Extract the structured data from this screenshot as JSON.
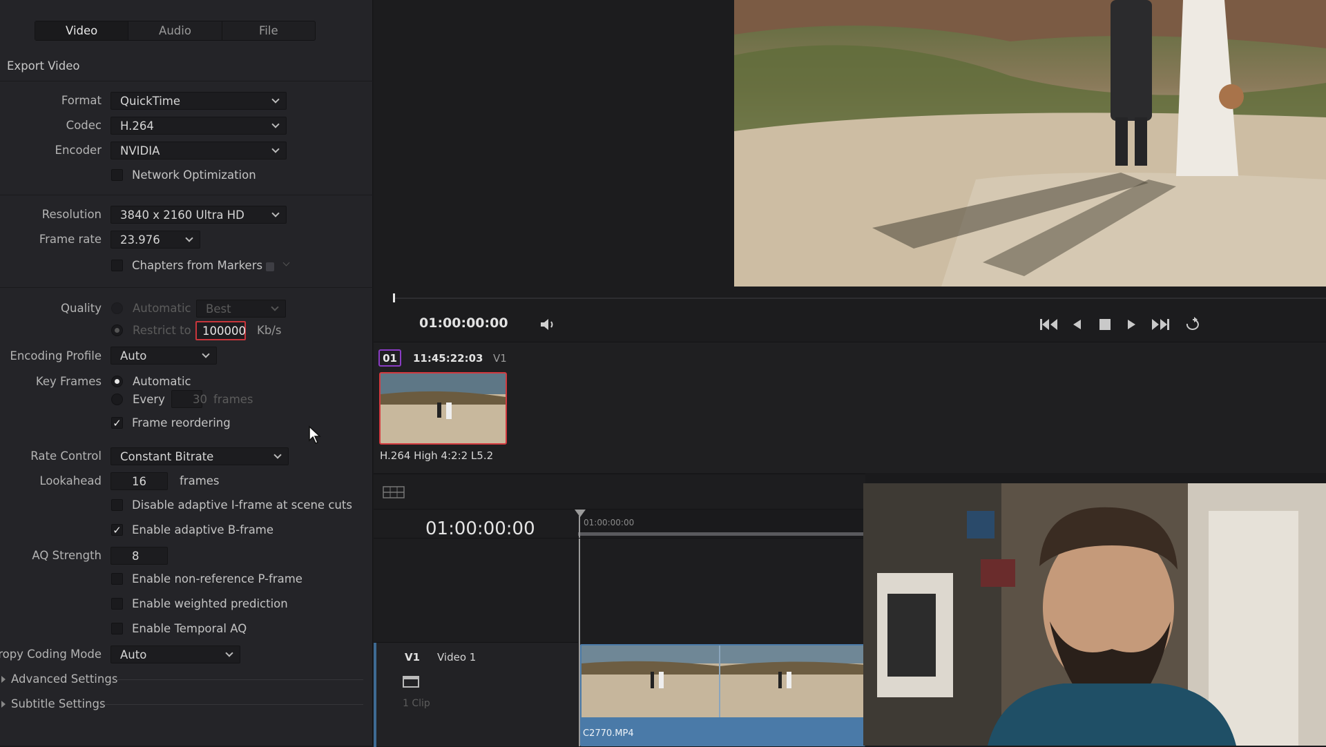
{
  "tabs": [
    "Video",
    "Audio",
    "File"
  ],
  "export_video_label": "Export Video",
  "format": {
    "label": "Format",
    "value": "QuickTime"
  },
  "codec": {
    "label": "Codec",
    "value": "H.264"
  },
  "encoder": {
    "label": "Encoder",
    "value": "NVIDIA"
  },
  "network_optimization": {
    "label": "Network Optimization",
    "checked": false
  },
  "resolution": {
    "label": "Resolution",
    "value": "3840 x 2160 Ultra HD"
  },
  "frame_rate": {
    "label": "Frame rate",
    "value": "23.976"
  },
  "chapters_from_markers": {
    "label": "Chapters from Markers",
    "checked": false
  },
  "quality": {
    "label": "Quality",
    "automatic_label": "Automatic",
    "best_value": "Best",
    "restrict_label": "Restrict to",
    "restrict_value": "100000",
    "unit": "Kb/s"
  },
  "encoding_profile": {
    "label": "Encoding Profile",
    "value": "Auto"
  },
  "key_frames": {
    "label": "Key Frames",
    "automatic_label": "Automatic",
    "every_label": "Every",
    "every_value": "30",
    "frames_unit": "frames"
  },
  "frame_reordering": {
    "label": "Frame reordering",
    "checked": true
  },
  "rate_control": {
    "label": "Rate Control",
    "value": "Constant Bitrate"
  },
  "lookahead": {
    "label": "Lookahead",
    "value": "16",
    "unit": "frames"
  },
  "disable_adaptive_iframe": {
    "label": "Disable adaptive I-frame at scene cuts",
    "checked": false
  },
  "enable_adaptive_bframe": {
    "label": "Enable adaptive B-frame",
    "checked": true
  },
  "aq_strength": {
    "label": "AQ Strength",
    "value": "8"
  },
  "enable_nonref_pframe": {
    "label": "Enable non-reference P-frame",
    "checked": false
  },
  "enable_weighted_prediction": {
    "label": "Enable weighted prediction",
    "checked": false
  },
  "enable_temporal_aq": {
    "label": "Enable Temporal AQ",
    "checked": false
  },
  "entropy_coding_mode": {
    "label": "tropy Coding Mode",
    "value": "Auto"
  },
  "advanced_settings": "Advanced Settings",
  "subtitle_settings": "Subtitle Settings",
  "viewer": {
    "timecode": "01:00:00:00"
  },
  "clip": {
    "index": "01",
    "timecode": "11:45:22:03",
    "track": "V1",
    "codec_info": "H.264 High 4:2:2 L5.2"
  },
  "timeline": {
    "timecode": "01:00:00:00",
    "ruler_timecode": "01:00:00:00",
    "track_id": "V1",
    "track_name": "Video 1",
    "clip_count": "1 Clip",
    "clip_name": "C2770.MP4"
  },
  "colors": {
    "accent_red": "#c9363c",
    "clip_blue": "#4a7aa8",
    "tab_active": "#1a1a1c"
  }
}
